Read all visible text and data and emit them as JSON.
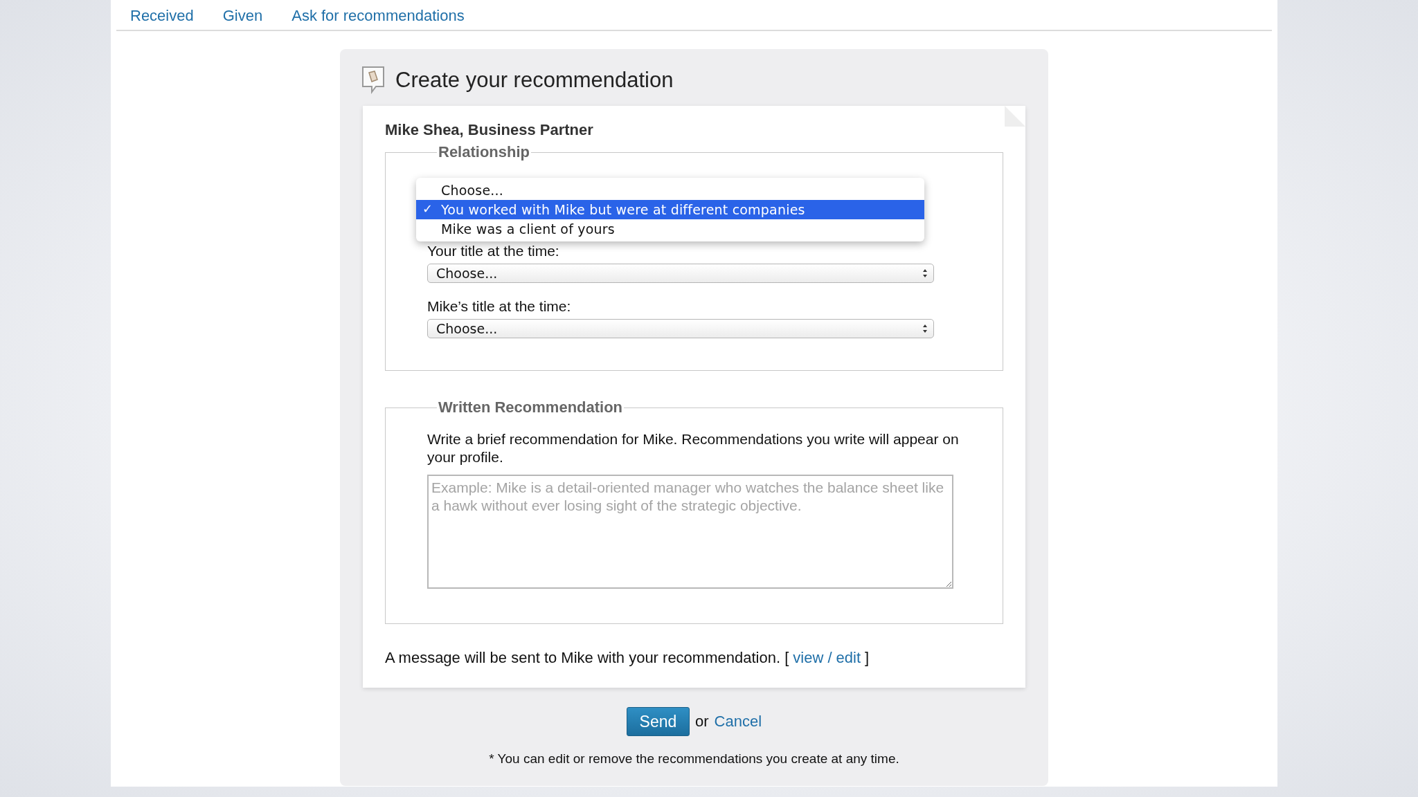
{
  "tabs": [
    {
      "label": "Received"
    },
    {
      "label": "Given"
    },
    {
      "label": "Ask for recommendations"
    }
  ],
  "form": {
    "title": "Create your recommendation",
    "recipient": "Mike Shea, Business Partner",
    "relationship": {
      "legend": "Relationship",
      "check_mark": "✓",
      "menu": [
        {
          "label": "Choose...",
          "selected": false
        },
        {
          "label": "You worked with Mike but were at different companies",
          "selected": true
        },
        {
          "label": "Mike was a client of yours",
          "selected": false
        }
      ],
      "fields": [
        {
          "label": "Your title at the time:",
          "value": "Choose..."
        },
        {
          "label": "Mike’s title at the time:",
          "value": "Choose..."
        }
      ]
    },
    "written": {
      "legend": "Written Recommendation",
      "instructions": "Write a brief recommendation for Mike. Recommendations you write will appear on your profile.",
      "placeholder": "Example: Mike is a detail-oriented manager who watches the balance sheet like a hawk without ever losing sight of the strategic objective."
    },
    "notice": "A message will be sent to Mike with your recommendation. [",
    "notice_link": "view / edit",
    "notice_end": "]",
    "send": "Send",
    "or": "or",
    "cancel": "Cancel",
    "footnote": "* You can edit or remove the recommendations you create at any time."
  }
}
